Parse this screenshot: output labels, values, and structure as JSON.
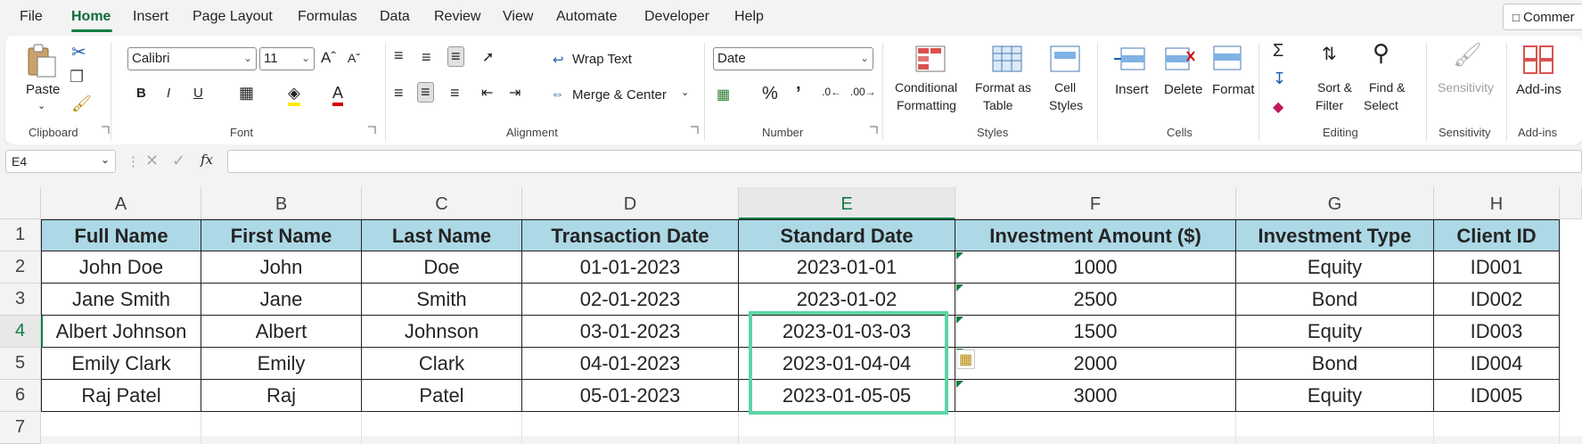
{
  "menu": {
    "items": [
      "File",
      "Home",
      "Insert",
      "Page Layout",
      "Formulas",
      "Data",
      "Review",
      "View",
      "Automate",
      "Developer",
      "Help"
    ],
    "active": "Home",
    "comments_label": "Commer"
  },
  "ribbon": {
    "clipboard": {
      "paste_label": "Paste",
      "group_label": "Clipboard"
    },
    "font": {
      "font_name": "Calibri",
      "font_size": "11",
      "group_label": "Font"
    },
    "alignment": {
      "wrap_text": "Wrap Text",
      "merge_center": "Merge & Center",
      "group_label": "Alignment"
    },
    "number": {
      "format": "Date",
      "group_label": "Number"
    },
    "styles": {
      "conditional_formatting": [
        "Conditional",
        "Formatting"
      ],
      "format_as_table": [
        "Format as",
        "Table"
      ],
      "cell_styles": [
        "Cell",
        "Styles"
      ],
      "group_label": "Styles"
    },
    "cells": {
      "insert": "Insert",
      "delete": "Delete",
      "format": "Format",
      "group_label": "Cells"
    },
    "editing": {
      "sort_filter": [
        "Sort &",
        "Filter"
      ],
      "find_select": [
        "Find &",
        "Select"
      ],
      "group_label": "Editing"
    },
    "sensitivity": {
      "label": "Sensitivity",
      "group_label": "Sensitivity"
    },
    "addins": {
      "label": "Add-ins",
      "group_label": "Add-ins"
    }
  },
  "formula_bar": {
    "name_box": "E4",
    "fx": "fx",
    "value": ""
  },
  "sheet": {
    "columns": [
      "A",
      "B",
      "C",
      "D",
      "E",
      "F",
      "G",
      "H"
    ],
    "selected_column": "E",
    "rows": [
      "1",
      "2",
      "3",
      "4",
      "5",
      "6",
      "7"
    ],
    "selected_row": "4",
    "headers": [
      "Full Name",
      "First Name",
      "Last Name",
      "Transaction Date",
      "Standard Date",
      "Investment Amount ($)",
      "Investment Type",
      "Client ID"
    ],
    "data": [
      [
        "John Doe",
        "John",
        "Doe",
        "01-01-2023",
        "2023-01-01",
        "1000",
        "Equity",
        "ID001"
      ],
      [
        "Jane Smith",
        "Jane",
        "Smith",
        "02-01-2023",
        "2023-01-02",
        "2500",
        "Bond",
        "ID002"
      ],
      [
        "Albert Johnson",
        "Albert",
        "Johnson",
        "03-01-2023",
        "2023-01-03-03",
        "1500",
        "Equity",
        "ID003"
      ],
      [
        "Emily Clark",
        "Emily",
        "Clark",
        "04-01-2023",
        "2023-01-04-04",
        "2000",
        "Bond",
        "ID004"
      ],
      [
        "Raj Patel",
        "Raj",
        "Patel",
        "05-01-2023",
        "2023-01-05-05",
        "3000",
        "Equity",
        "ID005"
      ]
    ]
  },
  "colors": {
    "accent": "#107c41",
    "header_fill": "#add8e6",
    "selection": "#5cd6a5"
  }
}
